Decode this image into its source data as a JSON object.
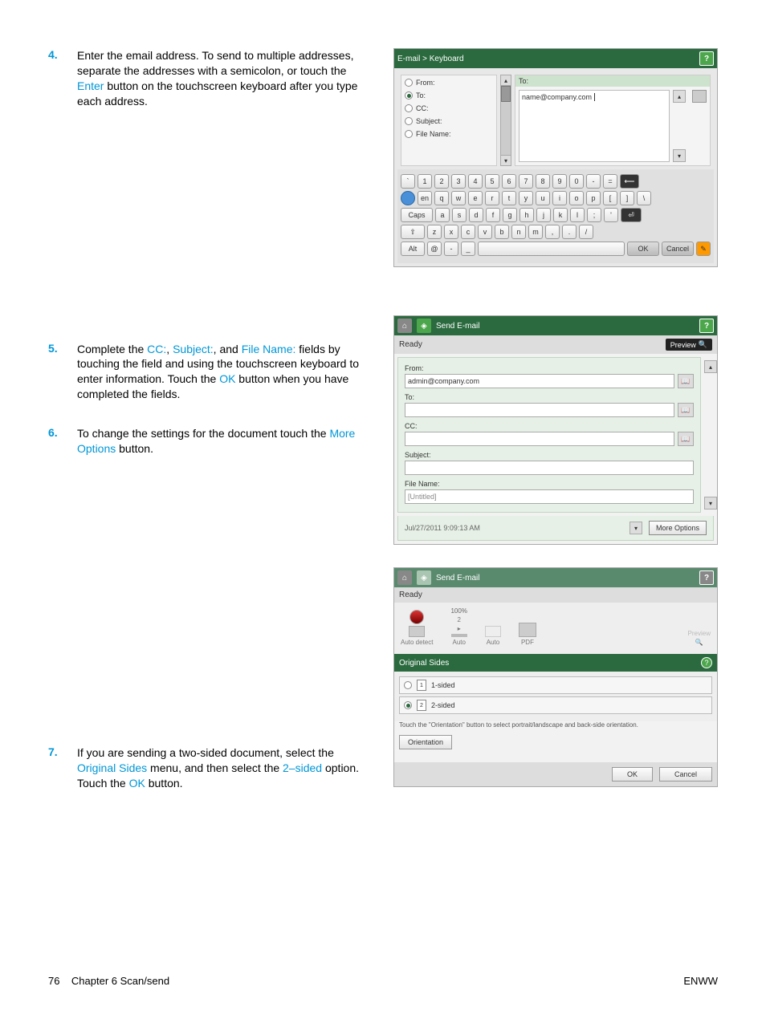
{
  "footer": {
    "page": "76",
    "chapter": "Chapter 6   Scan/send",
    "right": "ENWW"
  },
  "steps": {
    "s4": {
      "num": "4.",
      "text_a": "Enter the email address. To send to multiple addresses, separate the addresses with a semicolon, or touch the ",
      "hl1": "Enter",
      "text_b": " button on the touchscreen keyboard after you type each address."
    },
    "s5": {
      "num": "5.",
      "text_a": "Complete the ",
      "hl1": "CC:",
      "text_b": ", ",
      "hl2": "Subject:",
      "text_c": ", and ",
      "hl3": "File Name:",
      "text_d": " fields by touching the field and using the touchscreen keyboard to enter information. Touch the ",
      "hl4": "OK",
      "text_e": " button when you have completed the fields."
    },
    "s6": {
      "num": "6.",
      "text_a": "To change the settings for the document touch the ",
      "hl1": "More Options",
      "text_b": " button."
    },
    "s7": {
      "num": "7.",
      "text_a": "If you are sending a two-sided document, select the ",
      "hl1": "Original Sides",
      "text_b": " menu, and then select the ",
      "hl2": "2–sided",
      "text_c": " option. Touch the ",
      "hl3": "OK",
      "text_d": " button."
    }
  },
  "kb": {
    "title_a": "E-mail",
    "title_sep": " > ",
    "title_b": "Keyboard",
    "fields": {
      "from": "From:",
      "to": "To:",
      "cc": "CC:",
      "subject": "Subject:",
      "filename": "File Name:"
    },
    "right_hdr": "To:",
    "to_value": "name@company.com",
    "row1": [
      "`",
      "1",
      "2",
      "3",
      "4",
      "5",
      "6",
      "7",
      "8",
      "9",
      "0",
      "-",
      "="
    ],
    "row2": [
      "q",
      "w",
      "e",
      "r",
      "t",
      "y",
      "u",
      "i",
      "o",
      "p",
      "[",
      "]",
      "\\"
    ],
    "row3": [
      "a",
      "s",
      "d",
      "f",
      "g",
      "h",
      "j",
      "k",
      "l",
      ";",
      "'"
    ],
    "row4": [
      "z",
      "x",
      "c",
      "v",
      "b",
      "n",
      "m",
      ",",
      ".",
      "/"
    ],
    "caps": "Caps",
    "shift": "⇧",
    "alt": "Alt",
    "at": "@",
    "en": "en",
    "ok": "OK",
    "cancel": "Cancel",
    "back": "⟵",
    "enter": "⏎"
  },
  "se": {
    "title": "Send E-mail",
    "status": "Ready",
    "preview": "Preview",
    "from_l": "From:",
    "from_v": "admin@company.com",
    "to_l": "To:",
    "to_v": "",
    "cc_l": "CC:",
    "cc_v": "",
    "subj_l": "Subject:",
    "subj_v": "",
    "fn_l": "File Name:",
    "fn_v": "[Untitled]",
    "date": "Jul/27/2011 9:09:13 AM",
    "more": "More Options"
  },
  "os": {
    "title": "Send E-mail",
    "status": "Ready",
    "percent": "100%",
    "two": "2",
    "auto_detect": "Auto detect",
    "auto": "Auto",
    "auto2": "Auto",
    "pdf": "PDF",
    "preview": "Preview",
    "section": "Original Sides",
    "opt1": "1-sided",
    "opt1n": "1",
    "opt2": "2-sided",
    "opt2n": "2",
    "note": "Touch the \"Orientation\" button to select portrait/landscape and back-side orientation.",
    "orientation": "Orientation",
    "ok": "OK",
    "cancel": "Cancel"
  }
}
